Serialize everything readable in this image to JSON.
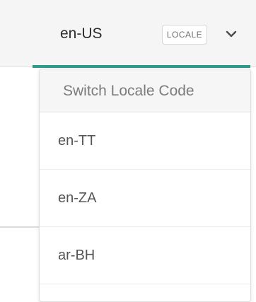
{
  "locale_selector": {
    "current": "en-US",
    "tag": "LOCALE",
    "chevron_icon": "chevron-down-icon",
    "accent_color": "#2e9b8b"
  },
  "dropdown": {
    "header": "Switch Locale Code",
    "options": [
      "en-TT",
      "en-ZA",
      "ar-BH"
    ]
  }
}
